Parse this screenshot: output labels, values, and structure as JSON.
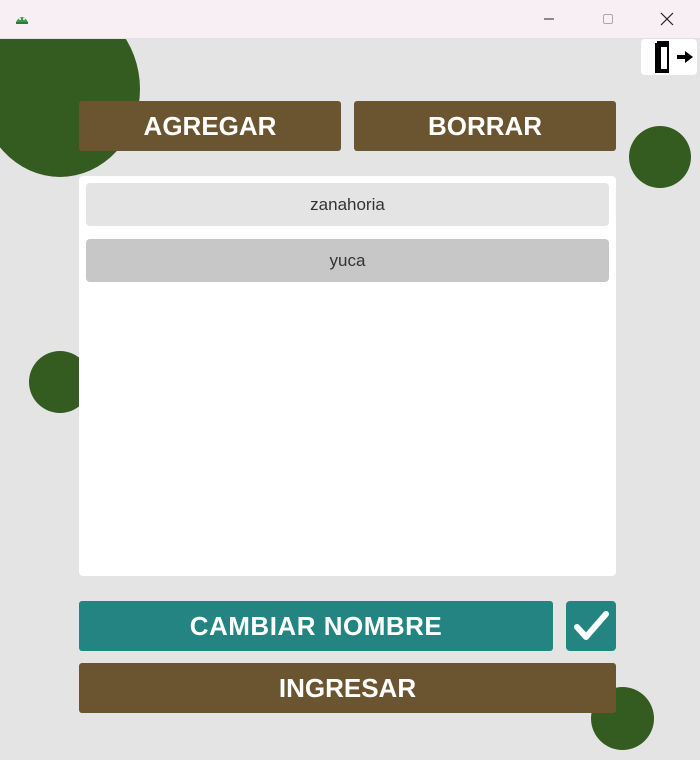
{
  "window": {
    "controls": {
      "minimize_icon": "minimize-icon",
      "maximize_icon": "maximize-icon",
      "close_icon": "close-icon"
    }
  },
  "buttons": {
    "add": "AGREGAR",
    "delete": "BORRAR",
    "rename": "CAMBIAR NOMBRE",
    "enter": "INGRESAR"
  },
  "list": {
    "items": [
      "zanahoria",
      "yuca"
    ],
    "selected_index": 1
  },
  "colors": {
    "brown": "#6b5530",
    "teal": "#238481",
    "green": "#345b20",
    "background": "#e4e4e4"
  }
}
